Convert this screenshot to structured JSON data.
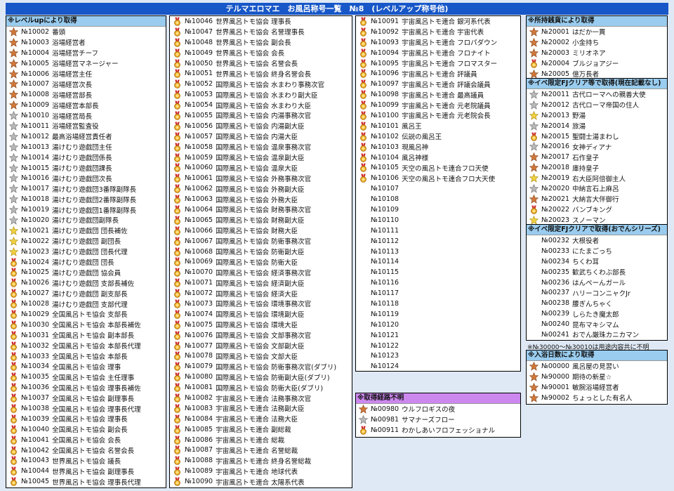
{
  "title": "テルマエロマエ　お風呂称号一覧　№8　(レベルアップ称号他)",
  "left_column": {
    "header": "※レベルupにより取得",
    "items": [
      {
        "no": "№10002",
        "name": "番頭",
        "icon": "bronze-star"
      },
      {
        "no": "№10003",
        "name": "浴場経営者",
        "icon": "bronze-star"
      },
      {
        "no": "№10004",
        "name": "浴場経営チーフ",
        "icon": "bronze-star"
      },
      {
        "no": "№10005",
        "name": "浴場経営マネージャー",
        "icon": "bronze-star"
      },
      {
        "no": "№10006",
        "name": "浴場経営主任",
        "icon": "bronze-star"
      },
      {
        "no": "№10007",
        "name": "浴場経営次長",
        "icon": "bronze-star"
      },
      {
        "no": "№10008",
        "name": "浴場経営部長",
        "icon": "bronze-star"
      },
      {
        "no": "№10009",
        "name": "浴場経営本部長",
        "icon": "bronze-star"
      },
      {
        "no": "№10010",
        "name": "浴場経営局長",
        "icon": "silver-star"
      },
      {
        "no": "№10011",
        "name": "浴場経営監査役",
        "icon": "silver-star"
      },
      {
        "no": "№10012",
        "name": "最高浴場経営責任者",
        "icon": "silver-star"
      },
      {
        "no": "№10013",
        "name": "湯けむり遊戯団主任",
        "icon": "silver-star"
      },
      {
        "no": "№10014",
        "name": "湯けむり遊戯団係長",
        "icon": "silver-star"
      },
      {
        "no": "№10015",
        "name": "湯けむり遊戯団課長",
        "icon": "silver-star"
      },
      {
        "no": "№10016",
        "name": "湯けむり遊戯団次長",
        "icon": "silver-star"
      },
      {
        "no": "№10017",
        "name": "湯けむり遊戯団3番隊副隊長",
        "icon": "silver-star"
      },
      {
        "no": "№10018",
        "name": "湯けむり遊戯団2番隊副隊長",
        "icon": "silver-star"
      },
      {
        "no": "№10019",
        "name": "湯けむり遊戯団1番隊副隊長",
        "icon": "silver-star"
      },
      {
        "no": "№10020",
        "name": "湯けむり遊戯団副隊長",
        "icon": "silver-star"
      },
      {
        "no": "№10021",
        "name": "湯けむり遊戯団 団長補佐",
        "icon": "gold-star"
      },
      {
        "no": "№10022",
        "name": "湯けむり遊戯団 副団長",
        "icon": "gold-star"
      },
      {
        "no": "№10023",
        "name": "湯けむり遊戯団 団長代理",
        "icon": "gold-star"
      },
      {
        "no": "№10024",
        "name": "湯けむり遊戯団 団長",
        "icon": "medal"
      },
      {
        "no": "№10025",
        "name": "湯けむり遊戯団 協会員",
        "icon": "medal"
      },
      {
        "no": "№10026",
        "name": "湯けむり遊戯団 支部長補佐",
        "icon": "medal"
      },
      {
        "no": "№10027",
        "name": "湯けむり遊戯団 副支部長",
        "icon": "medal"
      },
      {
        "no": "№10028",
        "name": "湯けむり遊戯団 支部代理",
        "icon": "medal"
      },
      {
        "no": "№10029",
        "name": "全国風呂トモ協会 支部長",
        "icon": "medal"
      },
      {
        "no": "№10030",
        "name": "全国風呂トモ協会 本部長補佐",
        "icon": "medal"
      },
      {
        "no": "№10031",
        "name": "全国風呂トモ協会 副本部長",
        "icon": "medal"
      },
      {
        "no": "№10032",
        "name": "全国風呂トモ協会 本部長代理",
        "icon": "medal"
      },
      {
        "no": "№10033",
        "name": "全国風呂トモ協会 本部長",
        "icon": "medal"
      },
      {
        "no": "№10034",
        "name": "全国風呂トモ協会 理事",
        "icon": "medal"
      },
      {
        "no": "№10035",
        "name": "全国風呂トモ協会 主任理事",
        "icon": "medal"
      },
      {
        "no": "№10036",
        "name": "全国風呂トモ協会 理事長補佐",
        "icon": "medal"
      },
      {
        "no": "№10037",
        "name": "全国風呂トモ協会 副理事長",
        "icon": "medal"
      },
      {
        "no": "№10038",
        "name": "全国風呂トモ協会 理事長代理",
        "icon": "medal"
      },
      {
        "no": "№10039",
        "name": "全国風呂トモ協会 理事長",
        "icon": "medal"
      },
      {
        "no": "№10040",
        "name": "全国風呂トモ協会 副会長",
        "icon": "medal"
      },
      {
        "no": "№10041",
        "name": "全国風呂トモ協会 会長",
        "icon": "medal"
      },
      {
        "no": "№10042",
        "name": "全国風呂トモ協会 名誉会長",
        "icon": "medal"
      },
      {
        "no": "№10043",
        "name": "世界風呂トモ協会 議長",
        "icon": "medal"
      },
      {
        "no": "№10044",
        "name": "世界風呂トモ協会 副理事長",
        "icon": "medal"
      },
      {
        "no": "№10045",
        "name": "世界風呂トモ協会 理事長代理",
        "icon": "medal"
      }
    ]
  },
  "middle_column": {
    "items": [
      {
        "no": "№10046",
        "name": "世界風呂トモ協会 理事長",
        "icon": "medal"
      },
      {
        "no": "№10047",
        "name": "世界風呂トモ協会 名誉理事長",
        "icon": "medal"
      },
      {
        "no": "№10048",
        "name": "世界風呂トモ協会 副会長",
        "icon": "medal"
      },
      {
        "no": "№10049",
        "name": "世界風呂トモ協会 会長",
        "icon": "medal"
      },
      {
        "no": "№10050",
        "name": "世界風呂トモ協会 名誉会長",
        "icon": "medal"
      },
      {
        "no": "№10051",
        "name": "世界風呂トモ協会 終身名誉会長",
        "icon": "medal"
      },
      {
        "no": "№10052",
        "name": "国際風呂トモ協会 水まわり事務次官",
        "icon": "medal"
      },
      {
        "no": "№10053",
        "name": "国際風呂トモ協会 水まわり副大臣",
        "icon": "medal"
      },
      {
        "no": "№10054",
        "name": "国際風呂トモ協会 水まわり大臣",
        "icon": "medal"
      },
      {
        "no": "№10055",
        "name": "国際風呂トモ協会 内湯事務次官",
        "icon": "medal"
      },
      {
        "no": "№10056",
        "name": "国際風呂トモ協会 内湯副大臣",
        "icon": "medal"
      },
      {
        "no": "№10057",
        "name": "国際風呂トモ協会 内湯大臣",
        "icon": "medal"
      },
      {
        "no": "№10058",
        "name": "国際風呂トモ協会 温泉事務次官",
        "icon": "medal"
      },
      {
        "no": "№10059",
        "name": "国際風呂トモ協会 温泉副大臣",
        "icon": "medal"
      },
      {
        "no": "№10060",
        "name": "国際風呂トモ協会 温泉大臣",
        "icon": "medal"
      },
      {
        "no": "№10061",
        "name": "国際風呂トモ協会 外務事務次官",
        "icon": "medal"
      },
      {
        "no": "№10062",
        "name": "国際風呂トモ協会 外務副大臣",
        "icon": "medal"
      },
      {
        "no": "№10063",
        "name": "国際風呂トモ協会 外務大臣",
        "icon": "medal"
      },
      {
        "no": "№10064",
        "name": "国際風呂トモ協会 財務事務次官",
        "icon": "medal"
      },
      {
        "no": "№10065",
        "name": "国際風呂トモ協会 財務副大臣",
        "icon": "medal"
      },
      {
        "no": "№10066",
        "name": "国際風呂トモ協会 財務大臣",
        "icon": "medal"
      },
      {
        "no": "№10067",
        "name": "国際風呂トモ協会 防衛事務次官",
        "icon": "medal"
      },
      {
        "no": "№10068",
        "name": "国際風呂トモ協会 防衛副大臣",
        "icon": "medal"
      },
      {
        "no": "№10069",
        "name": "国際風呂トモ協会 防衛大臣",
        "icon": "medal"
      },
      {
        "no": "№10070",
        "name": "国際風呂トモ協会 経済事務次官",
        "icon": "medal"
      },
      {
        "no": "№10071",
        "name": "国際風呂トモ協会 経済副大臣",
        "icon": "medal"
      },
      {
        "no": "№10072",
        "name": "国際風呂トモ協会 経済大臣",
        "icon": "medal"
      },
      {
        "no": "№10073",
        "name": "国際風呂トモ協会 環境事務次官",
        "icon": "medal"
      },
      {
        "no": "№10074",
        "name": "国際風呂トモ協会 環境副大臣",
        "icon": "medal"
      },
      {
        "no": "№10075",
        "name": "国際風呂トモ協会 環境大臣",
        "icon": "medal"
      },
      {
        "no": "№10076",
        "name": "国際風呂トモ協会 文部事務次官",
        "icon": "medal"
      },
      {
        "no": "№10077",
        "name": "国際風呂トモ協会 文部副大臣",
        "icon": "medal"
      },
      {
        "no": "№10078",
        "name": "国際風呂トモ協会 文部大臣",
        "icon": "medal"
      },
      {
        "no": "№10079",
        "name": "国際風呂トモ協会 防衛事務次官(ダブリ)",
        "icon": "medal"
      },
      {
        "no": "№10080",
        "name": "国際風呂トモ協会 防衛副大臣(ダブリ)",
        "icon": "medal"
      },
      {
        "no": "№10081",
        "name": "国際風呂トモ協会 防衛大臣(ダブリ)",
        "icon": "medal"
      },
      {
        "no": "№10082",
        "name": "宇宙風呂トモ連合 法務事務次官",
        "icon": "medal"
      },
      {
        "no": "№10083",
        "name": "宇宙風呂トモ連合 法務副大臣",
        "icon": "medal"
      },
      {
        "no": "№10084",
        "name": "宇宙風呂トモ連合 法務大臣",
        "icon": "medal"
      },
      {
        "no": "№10085",
        "name": "宇宙風呂トモ連合 副総裁",
        "icon": "medal"
      },
      {
        "no": "№10086",
        "name": "宇宙風呂トモ連合 総裁",
        "icon": "medal"
      },
      {
        "no": "№10087",
        "name": "宇宙風呂トモ連合 名誉総裁",
        "icon": "medal"
      },
      {
        "no": "№10088",
        "name": "宇宙風呂トモ連合 終身名誉総裁",
        "icon": "medal"
      },
      {
        "no": "№10089",
        "name": "宇宙風呂トモ連合 地球代表",
        "icon": "medal"
      },
      {
        "no": "№10090",
        "name": "宇宙風呂トモ連合 太陽系代表",
        "icon": "medal"
      }
    ]
  },
  "right_middle_column": {
    "items": [
      {
        "no": "№10091",
        "name": "宇宙風呂トモ連合 銀河系代表",
        "icon": "medal"
      },
      {
        "no": "№10092",
        "name": "宇宙風呂トモ連合 宇宙代表",
        "icon": "medal"
      },
      {
        "no": "№10093",
        "name": "宇宙風呂トモ連合 フロパダウン",
        "icon": "medal"
      },
      {
        "no": "№10094",
        "name": "宇宙風呂トモ連合 フロナイト",
        "icon": "medal"
      },
      {
        "no": "№10095",
        "name": "宇宙風呂トモ連合 フロマスター",
        "icon": "medal"
      },
      {
        "no": "№10096",
        "name": "宇宙風呂トモ連合 評議員",
        "icon": "medal"
      },
      {
        "no": "№10097",
        "name": "宇宙風呂トモ連合 評議会議員",
        "icon": "medal"
      },
      {
        "no": "№10098",
        "name": "宇宙風呂トモ連合 最高議員",
        "icon": "medal"
      },
      {
        "no": "№10099",
        "name": "宇宙風呂トモ連合 元老院議員",
        "icon": "medal"
      },
      {
        "no": "№10100",
        "name": "宇宙風呂トモ連合 元老院会長",
        "icon": "medal"
      },
      {
        "no": "№10101",
        "name": "風呂王",
        "icon": "medal"
      },
      {
        "no": "№10102",
        "name": "伝説の風呂王",
        "icon": "medal"
      },
      {
        "no": "№10103",
        "name": "現風呂神",
        "icon": "medal"
      },
      {
        "no": "№10104",
        "name": "風呂神様",
        "icon": "medal"
      },
      {
        "no": "№10105",
        "name": "天空の風呂トモ連合フロ天使",
        "icon": "medal"
      },
      {
        "no": "№10106",
        "name": "天空の風呂トモ連合フロ大天使",
        "icon": "medal"
      },
      {
        "no": "№10107",
        "name": "",
        "icon": ""
      },
      {
        "no": "№10108",
        "name": "",
        "icon": ""
      },
      {
        "no": "№10109",
        "name": "",
        "icon": ""
      },
      {
        "no": "№10110",
        "name": "",
        "icon": ""
      },
      {
        "no": "№10111",
        "name": "",
        "icon": ""
      },
      {
        "no": "№10112",
        "name": "",
        "icon": ""
      },
      {
        "no": "№10113",
        "name": "",
        "icon": ""
      },
      {
        "no": "№10114",
        "name": "",
        "icon": ""
      },
      {
        "no": "№10115",
        "name": "",
        "icon": ""
      },
      {
        "no": "№10116",
        "name": "",
        "icon": ""
      },
      {
        "no": "№10117",
        "name": "",
        "icon": ""
      },
      {
        "no": "№10118",
        "name": "",
        "icon": ""
      },
      {
        "no": "№10119",
        "name": "",
        "icon": ""
      },
      {
        "no": "№10120",
        "name": "",
        "icon": ""
      },
      {
        "no": "№10121",
        "name": "",
        "icon": ""
      },
      {
        "no": "№10122",
        "name": "",
        "icon": ""
      },
      {
        "no": "№10123",
        "name": "",
        "icon": ""
      },
      {
        "no": "№10124",
        "name": "",
        "icon": ""
      }
    ],
    "unknown": {
      "header": "※取得経路不明",
      "items": [
        {
          "no": "№00980",
          "name": "ウルフロギスの夜",
          "icon": "bronze-star"
        },
        {
          "no": "№00981",
          "name": "サマナーズフロー",
          "icon": "silver-star"
        },
        {
          "no": "№00911",
          "name": "わかしあいフロフェッショナル",
          "icon": "medal"
        }
      ]
    }
  },
  "right_column": {
    "money": {
      "header": "※所持銭貨により取得",
      "items": [
        {
          "no": "№20001",
          "name": "はだか一貫",
          "icon": "bronze-star"
        },
        {
          "no": "№20002",
          "name": "小金持ち",
          "icon": "bronze-star"
        },
        {
          "no": "№20003",
          "name": "ミリオネア",
          "icon": "bronze-star"
        },
        {
          "no": "№20004",
          "name": "ブルジョアジー",
          "icon": "medal"
        },
        {
          "no": "№20005",
          "name": "億万長者",
          "icon": "bronze-star"
        }
      ]
    },
    "event": {
      "header": "※イベ限定FJクリア等で取得(現在記載なし)",
      "items": [
        {
          "no": "№20011",
          "name": "古代ローマへの親善大使",
          "icon": "silver-star"
        },
        {
          "no": "№20012",
          "name": "古代ローマ帝国の住人",
          "icon": "silver-star"
        },
        {
          "no": "№20013",
          "name": "野湯",
          "icon": "gold-star"
        },
        {
          "no": "№20014",
          "name": "旅湯",
          "icon": "silver-star"
        },
        {
          "no": "№20015",
          "name": "聖闘士湯まわし",
          "icon": "medal"
        },
        {
          "no": "№20016",
          "name": "女神ディアナ",
          "icon": "silver-star"
        },
        {
          "no": "№20017",
          "name": "石作皇子",
          "icon": "bronze-star"
        },
        {
          "no": "№20018",
          "name": "庫持皇子",
          "icon": "bronze-star"
        },
        {
          "no": "№20019",
          "name": "右大臣阿倍御主人",
          "icon": "gold-star"
        },
        {
          "no": "№20020",
          "name": "中納言石上麻呂",
          "icon": "silver-star"
        },
        {
          "no": "№20021",
          "name": "大納言大伴御行",
          "icon": "bronze-star"
        },
        {
          "no": "№20022",
          "name": "バンブキング",
          "icon": "medal"
        },
        {
          "no": "№20023",
          "name": "スノーマン",
          "icon": "gold-star"
        }
      ]
    },
    "oden": {
      "header": "※イベ限定FJクリアで取得(おでんシリーズ)",
      "items": [
        {
          "no": "№00232",
          "name": "大根役者",
          "icon": ""
        },
        {
          "no": "№00233",
          "name": "にたまごっち",
          "icon": ""
        },
        {
          "no": "№00234",
          "name": "ちくわ耳",
          "icon": ""
        },
        {
          "no": "№00235",
          "name": "歓武ちくわぶ部長",
          "icon": ""
        },
        {
          "no": "№00236",
          "name": "はんぺーんガール",
          "icon": ""
        },
        {
          "no": "№00237",
          "name": "ハリーコンニャクJr",
          "icon": ""
        },
        {
          "no": "№00238",
          "name": "腰ぎんちゃく",
          "icon": ""
        },
        {
          "no": "№00239",
          "name": "しらたき魔太郎",
          "icon": ""
        },
        {
          "no": "№00240",
          "name": "昆布マキシマム",
          "icon": ""
        },
        {
          "no": "№00241",
          "name": "おでん厳珠カニカマン",
          "icon": ""
        }
      ]
    },
    "note": "※№30000～№30010は用途内容共に不明",
    "bath": {
      "header": "※入浴日数により取得",
      "items": [
        {
          "no": "№00000",
          "name": "風呂屋の見習い",
          "icon": "bronze-star"
        },
        {
          "no": "№90000",
          "name": "期待の新星☆",
          "icon": "bronze-star"
        },
        {
          "no": "№90001",
          "name": "敏腕浴場経営者",
          "icon": "bronze-star"
        },
        {
          "no": "№90002",
          "name": "ちょっとした有名人",
          "icon": "bronze-star"
        }
      ]
    }
  },
  "colors": {
    "title_bg": "#1757c8",
    "section_blue": "#99ccee",
    "section_purple": "#cc88ee",
    "page_bg": "#dfe9f5",
    "bronze": "#d0783a",
    "silver": "#b8b8b8",
    "gold": "#f0d040",
    "medal": "#e2a21a"
  }
}
